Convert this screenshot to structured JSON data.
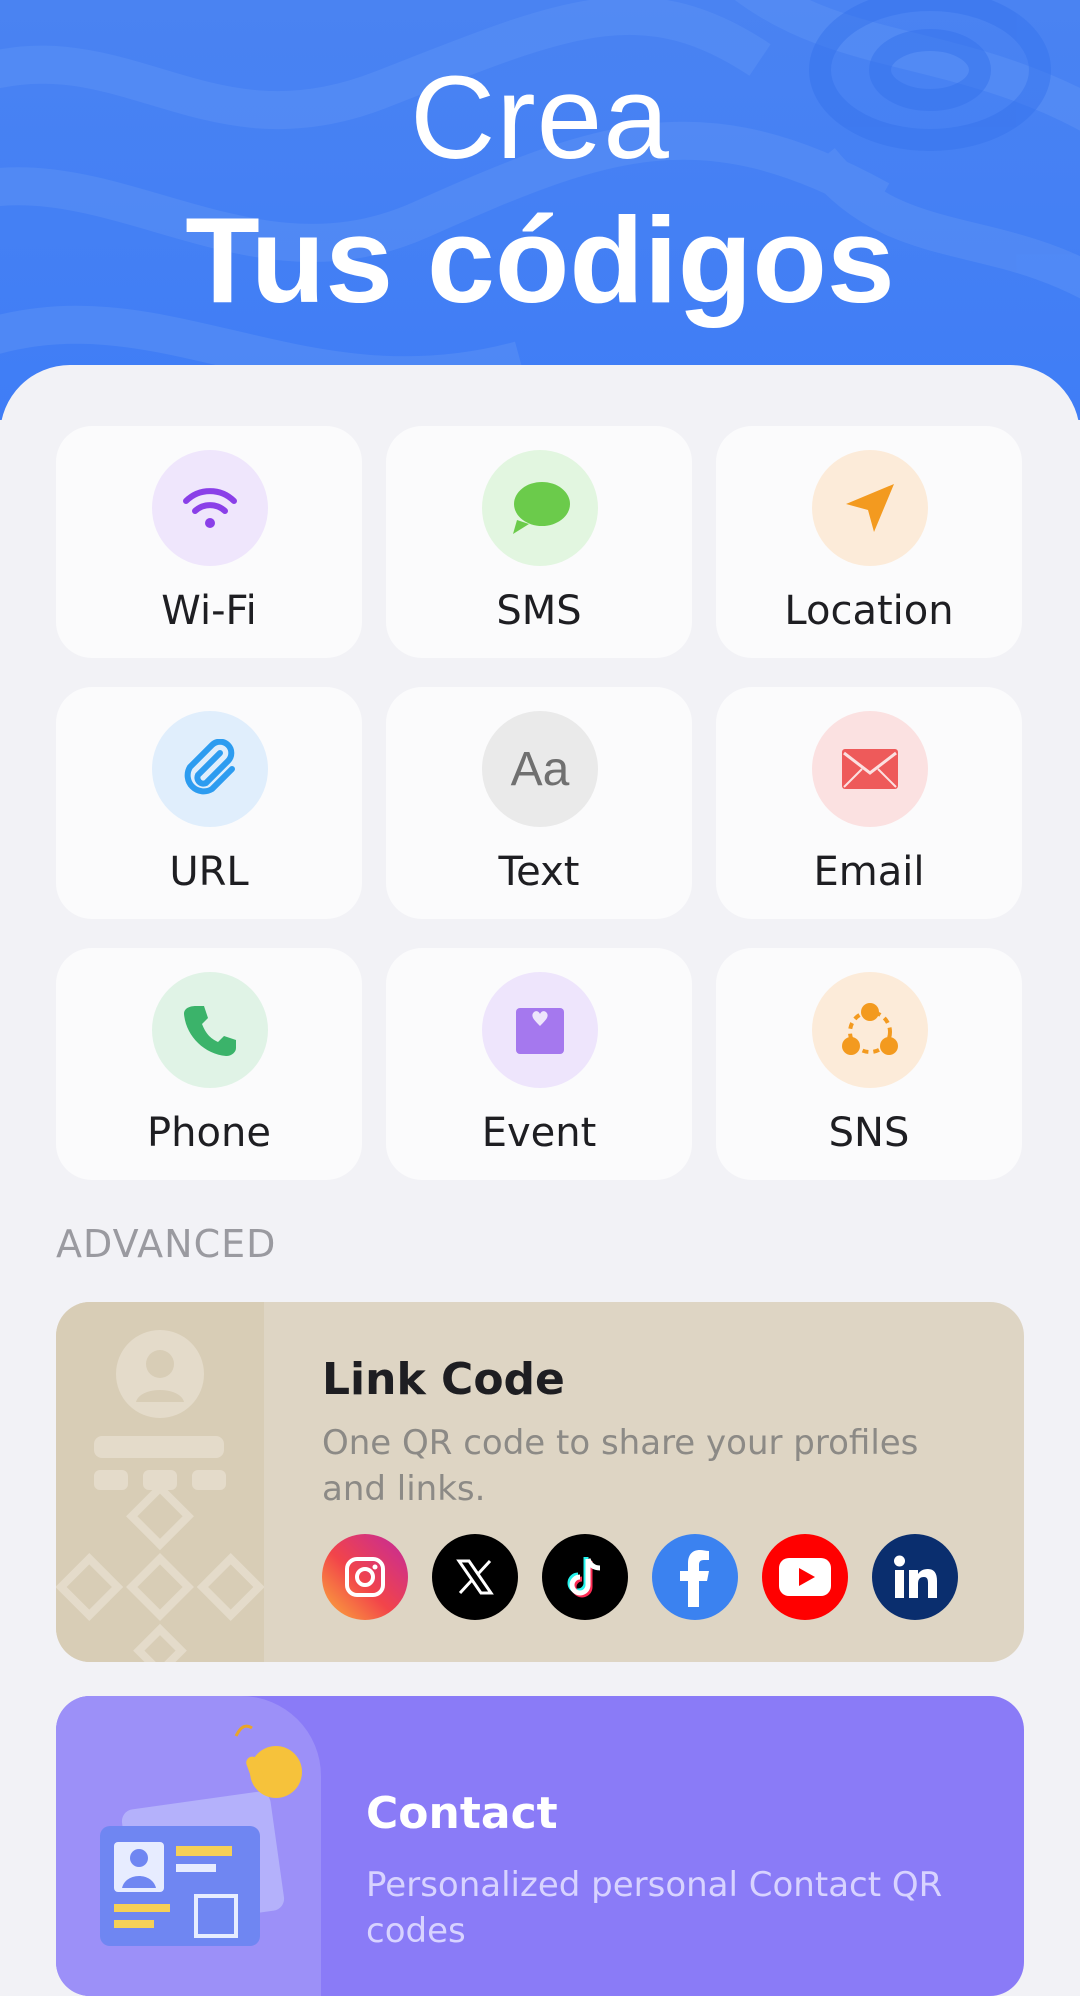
{
  "hero": {
    "line1": "Crea",
    "line2": "Tus códigos"
  },
  "tiles": [
    {
      "label": "Wi-Fi",
      "icon": "wifi-icon",
      "bg": "#EFE6FC",
      "color": "#8A3FE8"
    },
    {
      "label": "SMS",
      "icon": "message-icon",
      "bg": "#E2F6E0",
      "color": "#6BCB4B"
    },
    {
      "label": "Location",
      "icon": "location-arrow-icon",
      "bg": "#FCEBD9",
      "color": "#F39A1F"
    },
    {
      "label": "URL",
      "icon": "paperclip-icon",
      "bg": "#E0EEFC",
      "color": "#2D9CF0"
    },
    {
      "label": "Text",
      "icon": "text-icon",
      "bg": "#EAEAEA",
      "color": "#707070",
      "glyph": "Aa"
    },
    {
      "label": "Email",
      "icon": "envelope-icon",
      "bg": "#FBE1E1",
      "color": "#EE5A5A"
    },
    {
      "label": "Phone",
      "icon": "phone-icon",
      "bg": "#E0F3E6",
      "color": "#3BB36A"
    },
    {
      "label": "Event",
      "icon": "calendar-heart-icon",
      "bg": "#EEE5FC",
      "color": "#A578EE"
    },
    {
      "label": "SNS",
      "icon": "share-nodes-icon",
      "bg": "#FCEBD9",
      "color": "#F39A1F"
    }
  ],
  "advanced": {
    "section_title": "ADVANCED",
    "link_code": {
      "title": "Link Code",
      "description": "One QR code to share your profiles and links.",
      "socials": [
        "instagram-icon",
        "x-icon",
        "tiktok-icon",
        "facebook-icon",
        "youtube-icon",
        "linkedin-icon"
      ]
    },
    "contact": {
      "title": "Contact",
      "description": "Personalized personal Contact QR codes"
    }
  },
  "colors": {
    "hero_blue": "#4A83F2",
    "panel_bg": "#F2F2F6",
    "link_card_bg": "#DED5C4",
    "contact_card_bg": "#8A7BF7"
  }
}
